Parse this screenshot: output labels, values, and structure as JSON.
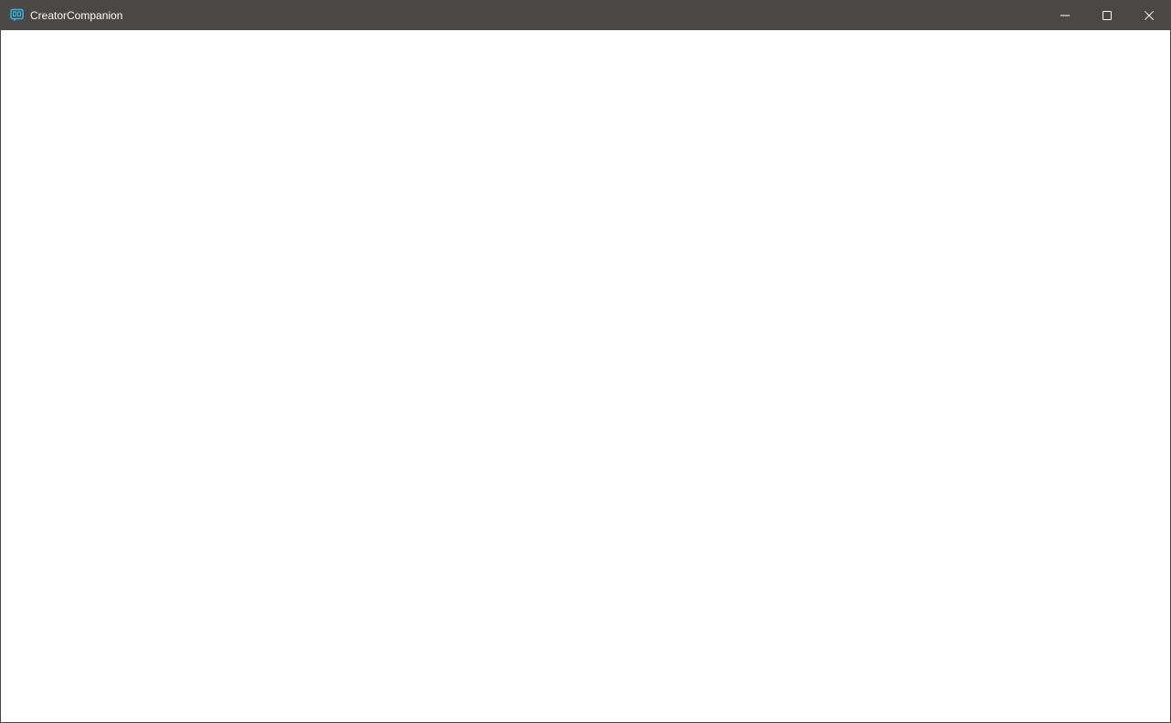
{
  "window": {
    "title": "CreatorCompanion",
    "app_icon": "vcc-app-icon",
    "controls": {
      "minimize_icon": "minimize-icon",
      "maximize_icon": "maximize-icon",
      "close_icon": "close-icon"
    }
  },
  "colors": {
    "titlebar_bg": "#4a4846",
    "titlebar_text": "#ffffff",
    "content_bg": "#ffffff",
    "app_icon_accent": "#35b8e8"
  }
}
